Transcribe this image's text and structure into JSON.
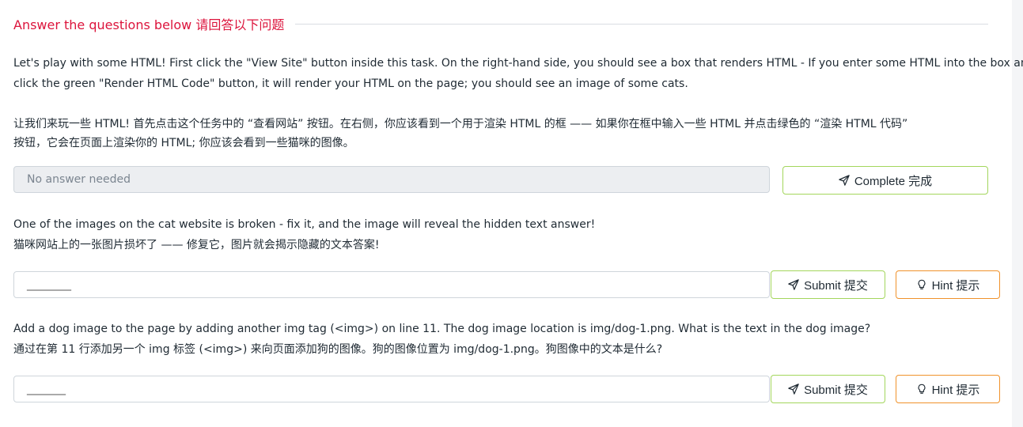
{
  "section": {
    "title": "Answer the questions below  请回答以下问题"
  },
  "task1": {
    "en_line1": "Let's play with some HTML! First click the \"View Site\" button inside this task. On the right-hand side, you should see a box that renders HTML - If you enter some HTML into the box and",
    "en_line2": "click the green \"Render HTML Code\" button, it will render your HTML on the page; you should see an image of some cats.",
    "zh_line1": "让我们来玩一些 HTML! 首先点击这个任务中的 “查看网站” 按钮。在右侧，你应该看到一个用于渲染 HTML 的框 —— 如果你在框中输入一些 HTML 并点击绿色的 “渲染 HTML 代码”",
    "zh_line2": "按钮，它会在页面上渲染你的 HTML; 你应该会看到一些猫咪的图像。",
    "answer_placeholder": "No answer needed",
    "complete_label": "Complete  完成"
  },
  "task2": {
    "en_line1": "One of the images on the cat website is broken - fix it, and the image will reveal the hidden text answer!",
    "zh_line1": "猫咪网站上的一张图片损坏了 —— 修复它，图片就会揭示隐藏的文本答案!",
    "answer_value": "________",
    "submit_label": "Submit  提交",
    "hint_label": "Hint   提示"
  },
  "task3": {
    "en_line1": "Add a dog image to the page by adding another img tag (<img>) on line 11. The dog image location is img/dog-1.png. What is the text in the dog image?",
    "zh_line1": "通过在第 11 行添加另一个 img 标签 (<img>) 来向页面添加狗的图像。狗的图像位置为 img/dog-1.png。狗图像中的文本是什么?",
    "answer_value": "_______",
    "submit_label": "Submit  提交",
    "hint_label": "Hint   提示"
  },
  "icons": {
    "complete": "send-icon",
    "submit": "send-icon",
    "hint": "lightbulb-icon"
  },
  "colors": {
    "title": "#dc143c",
    "complete_border": "#a3d65c",
    "hint_border": "#f0922b"
  }
}
